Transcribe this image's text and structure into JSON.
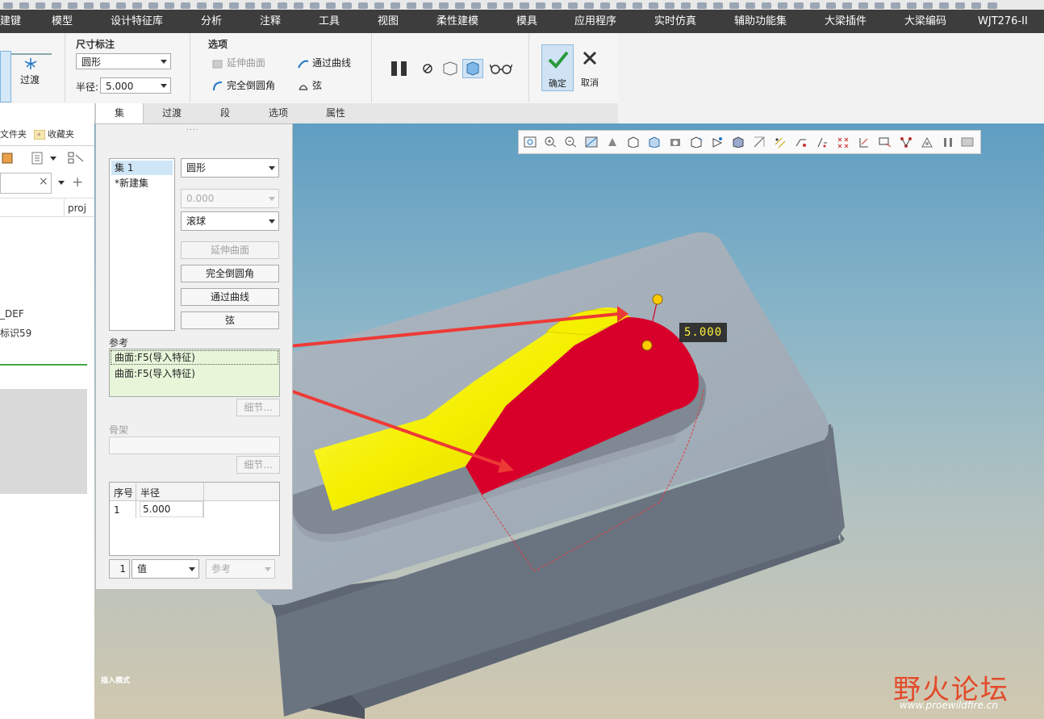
{
  "menubar": {
    "items": [
      "建键",
      "模型",
      "设计特征库",
      "分析",
      "注释",
      "工具",
      "视图",
      "柔性建模",
      "模具",
      "应用程序",
      "实时仿真",
      "辅助功能集",
      "大梁插件",
      "大梁编码",
      "WJT276-II"
    ]
  },
  "ribbon": {
    "transition_label": "过渡",
    "dimension_group": "尺寸标注",
    "shape_value": "圆形",
    "radius_label": "半径:",
    "radius_value": "5.000",
    "options_group": "选项",
    "extend_surfaces": "延伸曲面",
    "full_round": "完全倒圆角",
    "through_curve": "通过曲线",
    "chord": "弦",
    "ok_label": "确定",
    "cancel_label": "取消"
  },
  "tabs": [
    "集",
    "过渡",
    "段",
    "选项",
    "属性"
  ],
  "left_panel": {
    "folder_browser": "文件夹",
    "favorites": "收藏夹",
    "column_header": "proj",
    "item_def": "_DEF",
    "item_id": "标识59"
  },
  "panel": {
    "handle": "....",
    "sets": [
      "集 1",
      "*新建集"
    ],
    "shape": "圆形",
    "value_field": "0.000",
    "method": "滚球",
    "extend_surfaces": "延伸曲面",
    "full_round": "完全倒圆角",
    "through_curve": "通过曲线",
    "chord": "弦",
    "references_label": "参考",
    "references": [
      "曲面:F5(导入特征)",
      "曲面:F5(导入特征)"
    ],
    "details_button": "细节...",
    "skeleton_label": "骨架",
    "skeleton_details": "细节...",
    "table_headers": [
      "序号",
      "半径"
    ],
    "table_rows": [
      [
        "1",
        "5.000"
      ]
    ],
    "bottom_index": "1",
    "bottom_value": "值",
    "bottom_ref": "参考"
  },
  "viewport": {
    "dimension_tag": "5.000",
    "mode_text": "插入模式",
    "watermark_title": "野火论坛",
    "watermark_url": "www.proewildfire.cn"
  },
  "colors": {
    "menubar": "#3d3d3d",
    "selected_surface": "#ffff00",
    "highlight_surface": "#d8002a",
    "arrow": "#ee3a36",
    "accent_blue": "#1e78c8"
  }
}
